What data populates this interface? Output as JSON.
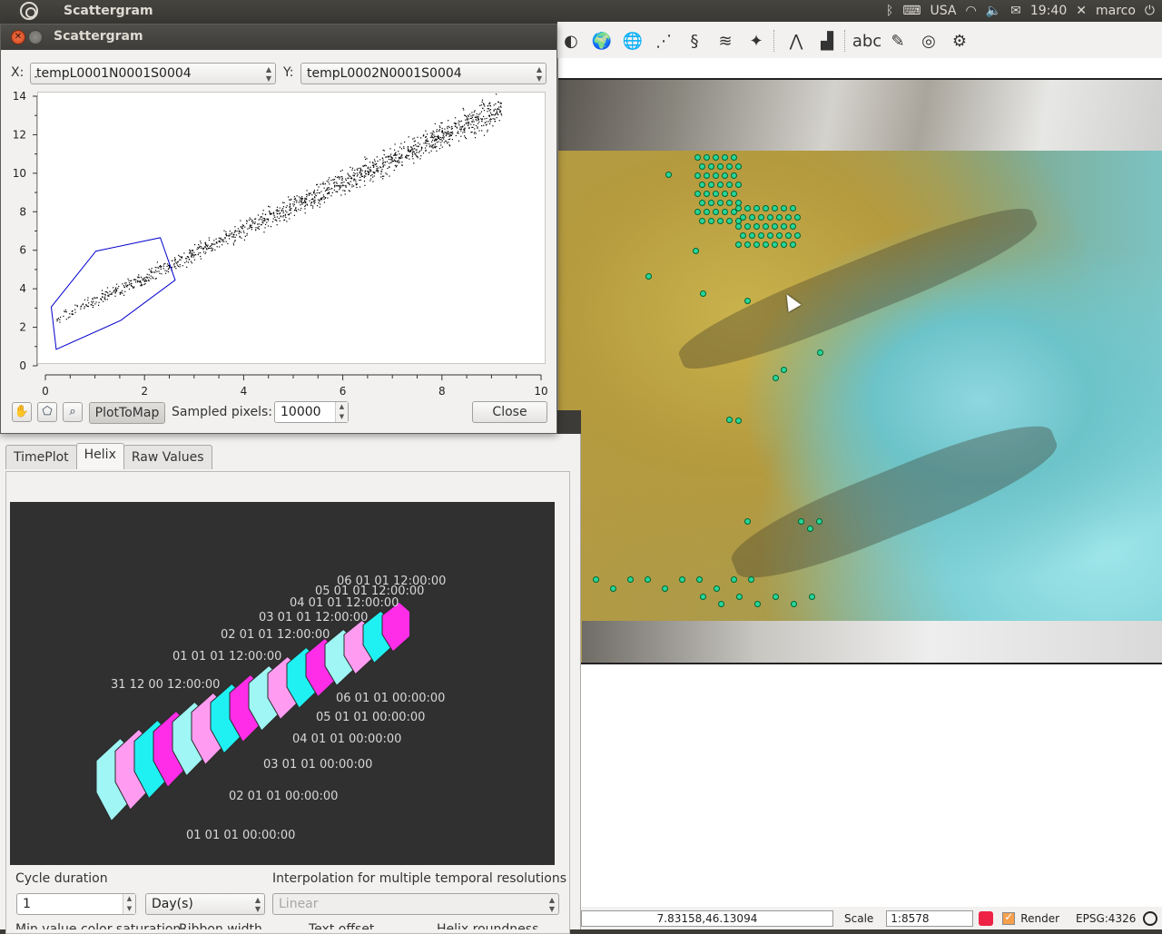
{
  "panel": {
    "app_title": "Scattergram",
    "keyboard": "USA",
    "clock": "19:40",
    "user": "marco"
  },
  "scatter_window": {
    "title": "Scattergram",
    "x_label": "X:",
    "x_value": "tempL0001N0001S0004",
    "y_label": "Y:",
    "y_value": "tempL0002N0001S0004",
    "plot_to_map_label": "PlotToMap",
    "sampled_label": "Sampled pixels:",
    "sampled_value": "10000",
    "close_label": "Close"
  },
  "chart_data": {
    "type": "scatter",
    "title": "",
    "xlabel": "",
    "ylabel": "",
    "xlim": [
      0,
      10
    ],
    "ylim": [
      0,
      14
    ],
    "x_ticks": [
      "0",
      "2",
      "4",
      "6",
      "8",
      "10"
    ],
    "y_ticks": [
      "0",
      "2",
      "4",
      "6",
      "8",
      "10",
      "12",
      "14"
    ],
    "trend": {
      "x_start": 0.2,
      "y_start": 2.5,
      "x_end": 9.2,
      "y_end": 13.5
    },
    "selection_polygon": [
      [
        0.1,
        3.1
      ],
      [
        1.0,
        6.0
      ],
      [
        2.3,
        6.7
      ],
      [
        2.6,
        4.5
      ],
      [
        1.5,
        2.4
      ],
      [
        0.2,
        0.9
      ]
    ],
    "point_color": "#000000",
    "polygon_color": "#0000cc",
    "grid": false
  },
  "dock": {
    "tabs": [
      {
        "label": "TimePlot"
      },
      {
        "label": "Helix"
      },
      {
        "label": "Raw Values"
      }
    ],
    "helix_labels_top": [
      "06 01 01 12:00:00",
      "05 01 01 12:00:00",
      "04 01 01 12:00:00",
      "03 01 01 12:00:00",
      "02 01 01 12:00:00",
      "01 01 01 12:00:00",
      "31 12 00 12:00:00"
    ],
    "helix_labels_bottom": [
      "06 01 01 00:00:00",
      "05 01 01 00:00:00",
      "04 01 01 00:00:00",
      "03 01 01 00:00:00",
      "02 01 01 00:00:00",
      "01 01 01 00:00:00"
    ],
    "cycle_label": "Cycle duration",
    "cycle_value": "1",
    "cycle_unit": "Day(s)",
    "interp_label": "Interpolation for multiple temporal resolutions",
    "interp_value": "Linear",
    "more_labels": [
      "Min value color saturation",
      "Ribbon width",
      "Text offset",
      "Helix roundness"
    ]
  },
  "statusbar": {
    "coords": "7.83158,46.13094",
    "scale_label": "Scale",
    "scale_value": "1:8578",
    "render_label": "Render",
    "epsg": "EPSG:4326"
  }
}
